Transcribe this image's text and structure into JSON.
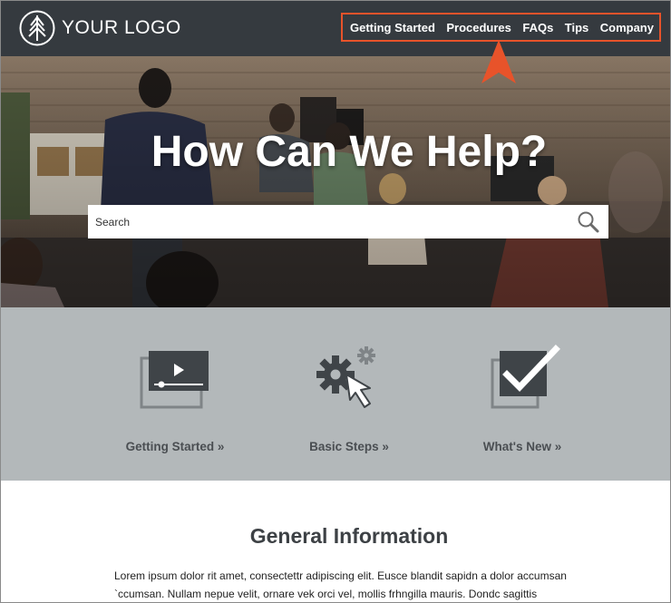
{
  "header": {
    "logo_text": "YOUR LOGO",
    "nav": [
      {
        "label": "Getting Started"
      },
      {
        "label": "Procedures"
      },
      {
        "label": "FAQs"
      },
      {
        "label": "Tips"
      },
      {
        "label": "Company"
      }
    ]
  },
  "hero": {
    "title": "How Can We Help?",
    "search": {
      "placeholder": "Search",
      "value": ""
    }
  },
  "features": [
    {
      "label": "Getting Started »",
      "icon": "video-player-icon"
    },
    {
      "label": "Basic Steps »",
      "icon": "gear-cursor-icon"
    },
    {
      "label": "What's New »",
      "icon": "checkbox-icon"
    }
  ],
  "info": {
    "title": "General Information",
    "body": "Lorem ipsum dolor rit amet, consectettr adipiscing elit. Eusce blandit sapidn a dolor accumsan `ccumsan. Nullam nepue velit, ornare vek orci vel, mollis frhngilla mauris. Dondc sagittis"
  },
  "colors": {
    "header_bg": "#353a3f",
    "callout": "#e8532a",
    "features_bg": "#b3b8ba",
    "icon_dark": "#3f4448"
  }
}
